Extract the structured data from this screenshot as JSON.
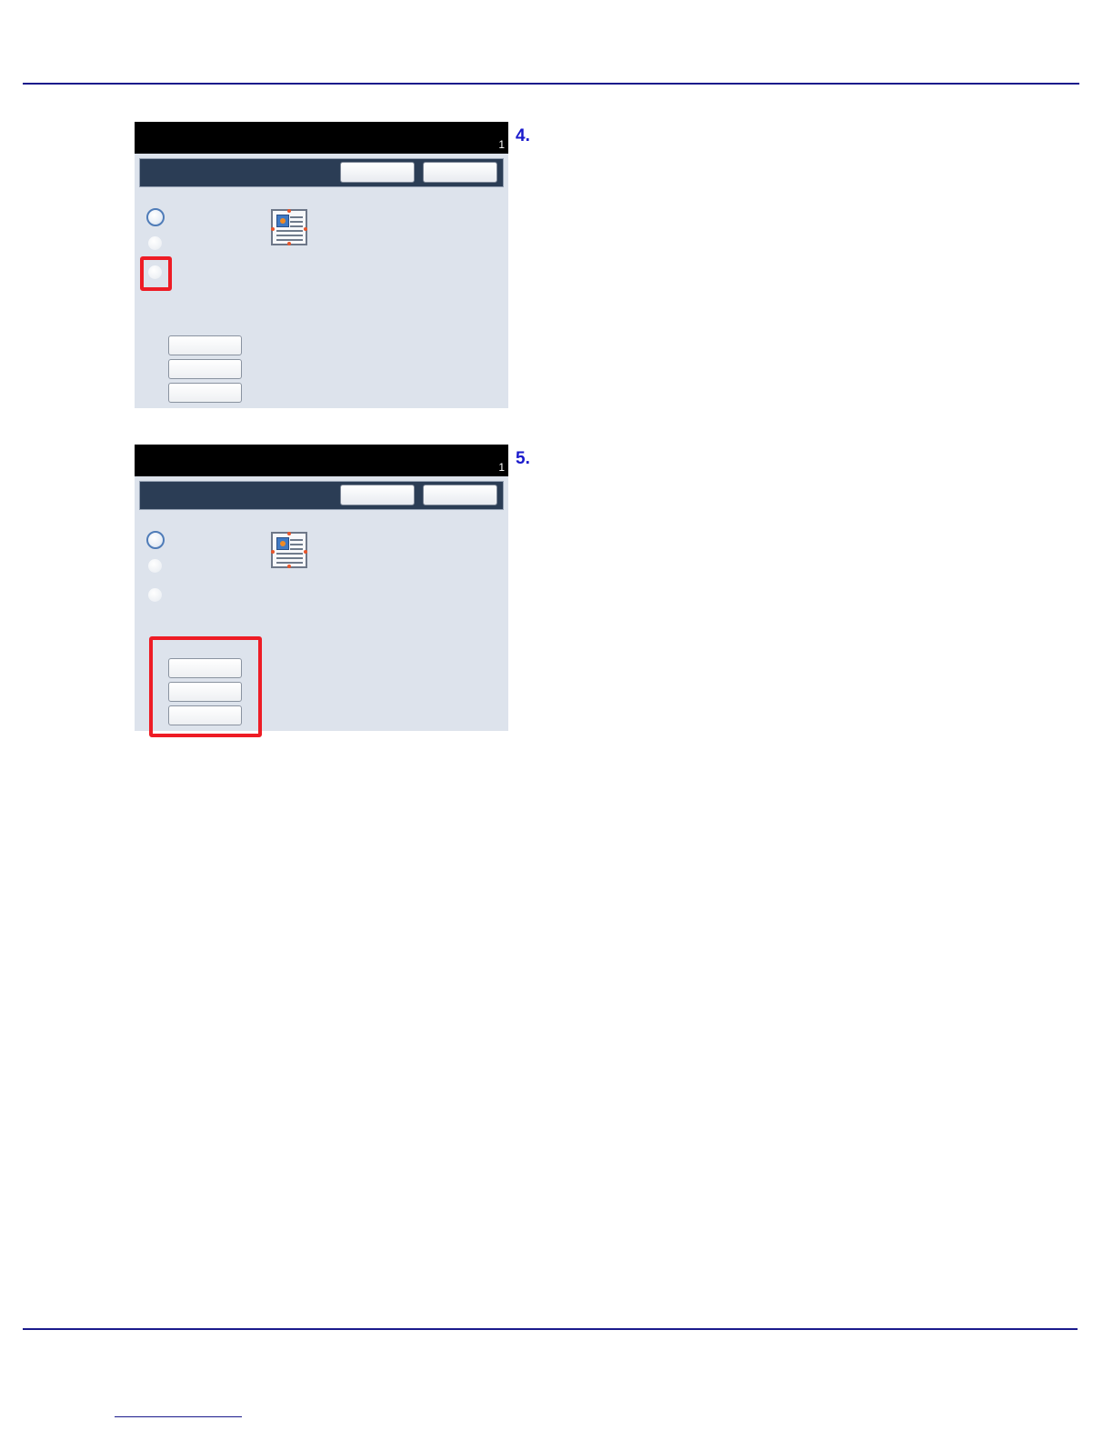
{
  "steps": [
    {
      "number": "4.",
      "screen": {
        "page_number": "1",
        "highlight": "third-radio-option"
      }
    },
    {
      "number": "5.",
      "screen": {
        "page_number": "1",
        "highlight": "option-buttons"
      }
    }
  ],
  "colors": {
    "rule": "#1a1a8c",
    "step_number": "#1a1acc",
    "highlight": "#ee1c25",
    "screen_background": "#dde3ec",
    "header_bar": "#2b3d55"
  },
  "icons": [
    "document-layout-icon"
  ]
}
